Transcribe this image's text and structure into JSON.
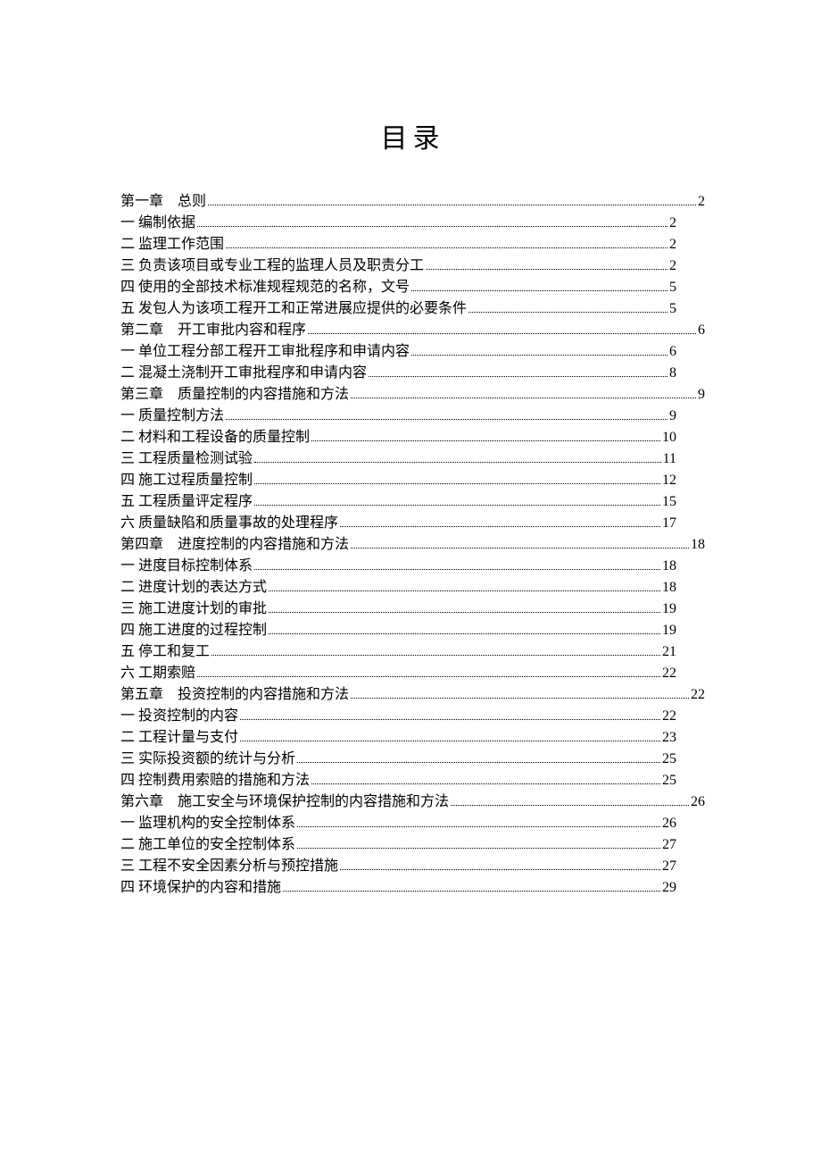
{
  "title": "目录",
  "entries": [
    {
      "level": "chapter",
      "label": "第一章 总则",
      "page": "2"
    },
    {
      "level": "sub",
      "label": "一 编制依据",
      "page": "2"
    },
    {
      "level": "sub",
      "label": "二 监理工作范围",
      "page": "2"
    },
    {
      "level": "sub",
      "label": "三 负责该项目或专业工程的监理人员及职责分工",
      "page": "2"
    },
    {
      "level": "sub",
      "label": "四 使用的全部技术标准规程规范的名称，文号",
      "page": "5"
    },
    {
      "level": "sub",
      "label": "五 发包人为该项工程开工和正常进展应提供的必要条件",
      "page": "5"
    },
    {
      "level": "chapter",
      "label": "第二章 开工审批内容和程序",
      "page": "6"
    },
    {
      "level": "sub",
      "label": "一 单位工程分部工程开工审批程序和申请内容",
      "page": "6"
    },
    {
      "level": "sub",
      "label": "二 混凝土浇制开工审批程序和申请内容",
      "page": "8"
    },
    {
      "level": "chapter",
      "label": "第三章 质量控制的内容措施和方法",
      "page": "9"
    },
    {
      "level": "sub",
      "label": "一 质量控制方法",
      "page": "9"
    },
    {
      "level": "sub",
      "label": "二 材料和工程设备的质量控制",
      "page": "10"
    },
    {
      "level": "sub",
      "label": "三 工程质量检测试验",
      "page": "11"
    },
    {
      "level": "sub",
      "label": "四 施工过程质量控制",
      "page": "12"
    },
    {
      "level": "sub",
      "label": "五 工程质量评定程序",
      "page": "15"
    },
    {
      "level": "sub",
      "label": "六 质量缺陷和质量事故的处理程序",
      "page": "17"
    },
    {
      "level": "chapter",
      "label": "第四章 进度控制的内容措施和方法",
      "page": "18"
    },
    {
      "level": "sub",
      "label": "一 进度目标控制体系",
      "page": "18"
    },
    {
      "level": "sub",
      "label": "二 进度计划的表达方式",
      "page": "18"
    },
    {
      "level": "sub",
      "label": "三 施工进度计划的审批",
      "page": "19"
    },
    {
      "level": "sub",
      "label": "四 施工进度的过程控制",
      "page": "19"
    },
    {
      "level": "sub",
      "label": "五 停工和复工",
      "page": "21"
    },
    {
      "level": "sub",
      "label": "六 工期索赔",
      "page": "22"
    },
    {
      "level": "chapter",
      "label": "第五章 投资控制的内容措施和方法",
      "page": "22"
    },
    {
      "level": "sub",
      "label": "一 投资控制的内容",
      "page": "22"
    },
    {
      "level": "sub",
      "label": "二 工程计量与支付",
      "page": "23"
    },
    {
      "level": "sub",
      "label": "三 实际投资额的统计与分析",
      "page": "25"
    },
    {
      "level": "sub",
      "label": "四 控制费用索赔的措施和方法",
      "page": "25"
    },
    {
      "level": "chapter",
      "label": "第六章 施工安全与环境保护控制的内容措施和方法",
      "page": "26"
    },
    {
      "level": "sub",
      "label": "一 监理机构的安全控制体系",
      "page": "26"
    },
    {
      "level": "sub",
      "label": "二 施工单位的安全控制体系",
      "page": "27"
    },
    {
      "level": "sub",
      "label": "三 工程不安全因素分析与预控措施",
      "page": "27"
    },
    {
      "level": "sub",
      "label": "四 环境保护的内容和措施",
      "page": "29"
    }
  ]
}
